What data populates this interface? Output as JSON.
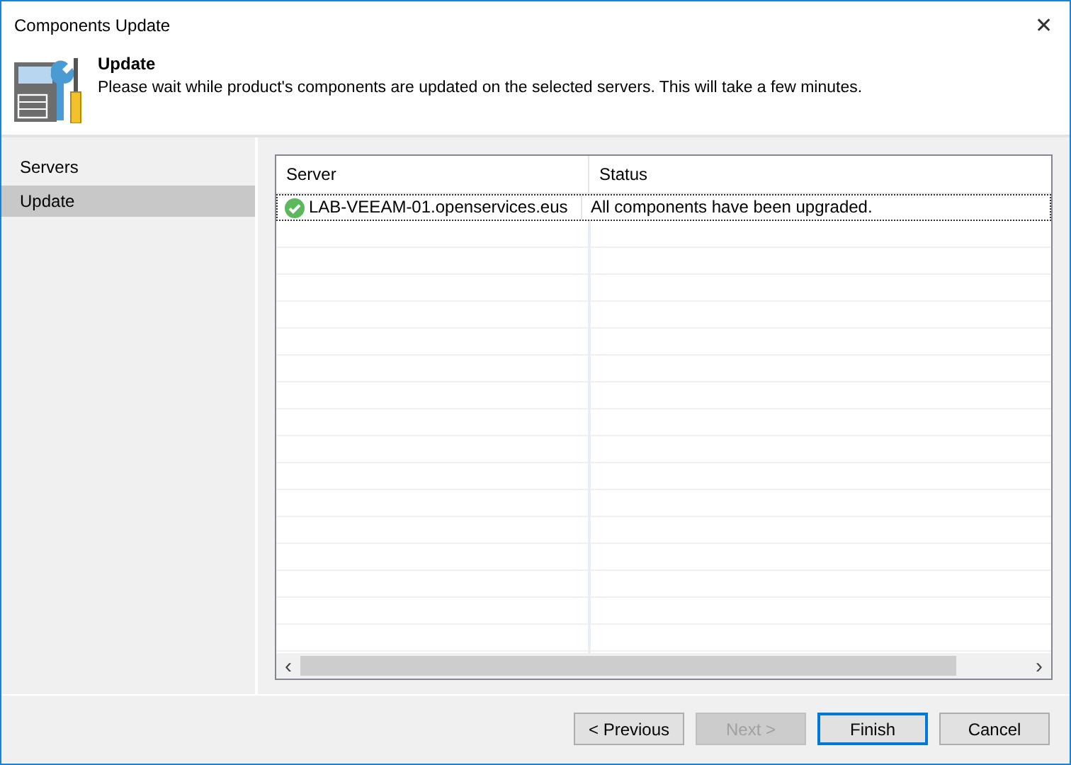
{
  "window": {
    "title": "Components Update",
    "close": "✕"
  },
  "header": {
    "title": "Update",
    "description": "Please wait while product's components are updated on the selected servers. This will take a few minutes."
  },
  "steps": [
    {
      "label": "Servers",
      "selected": false
    },
    {
      "label": "Update",
      "selected": true
    }
  ],
  "table": {
    "columns": [
      "Server",
      "Status"
    ],
    "rows": [
      {
        "server": "LAB-VEEAM-01.openservices.eus",
        "status": "All components have been upgraded.",
        "kind": "success",
        "selected": true
      }
    ],
    "scroll_left": "‹",
    "scroll_right": "›"
  },
  "buttons": [
    {
      "label": "< Previous",
      "disabled": false,
      "default": false
    },
    {
      "label": "Next >",
      "disabled": true,
      "default": false
    },
    {
      "label": "Finish",
      "disabled": false,
      "default": true
    },
    {
      "label": "Cancel",
      "disabled": false,
      "default": false
    }
  ]
}
